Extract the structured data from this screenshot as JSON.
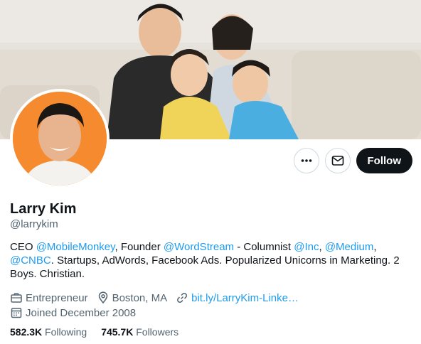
{
  "profile": {
    "name": "Larry Kim",
    "handle": "@larrykim"
  },
  "actions": {
    "more_icon": "more-dots-icon",
    "message_icon": "envelope-icon",
    "follow_label": "Follow"
  },
  "bio": {
    "segments": [
      {
        "text": "CEO ",
        "type": "text"
      },
      {
        "text": "@MobileMonkey",
        "type": "mention"
      },
      {
        "text": ", Founder ",
        "type": "text"
      },
      {
        "text": "@WordStream",
        "type": "mention"
      },
      {
        "text": " - Columnist ",
        "type": "text"
      },
      {
        "text": "@Inc",
        "type": "mention"
      },
      {
        "text": ", ",
        "type": "text"
      },
      {
        "text": "@Medium",
        "type": "mention"
      },
      {
        "text": ", ",
        "type": "text"
      },
      {
        "text": "@CNBC",
        "type": "mention"
      },
      {
        "text": ". Startups, AdWords, Facebook Ads. Popularized Unicorns in Marketing. 2 Boys. Christian.",
        "type": "text"
      }
    ]
  },
  "meta": {
    "profession": "Entrepreneur",
    "location": "Boston, MA",
    "link": "bit.ly/LarryKim-Linke…",
    "joined": "Joined December 2008"
  },
  "stats": {
    "following_count": "582.3K",
    "following_label": "Following",
    "followers_count": "745.7K",
    "followers_label": "Followers"
  },
  "colors": {
    "accent": "#1d9bf0",
    "text": "#0f1419",
    "secondary": "#536471",
    "follow_bg": "#0f1419"
  }
}
